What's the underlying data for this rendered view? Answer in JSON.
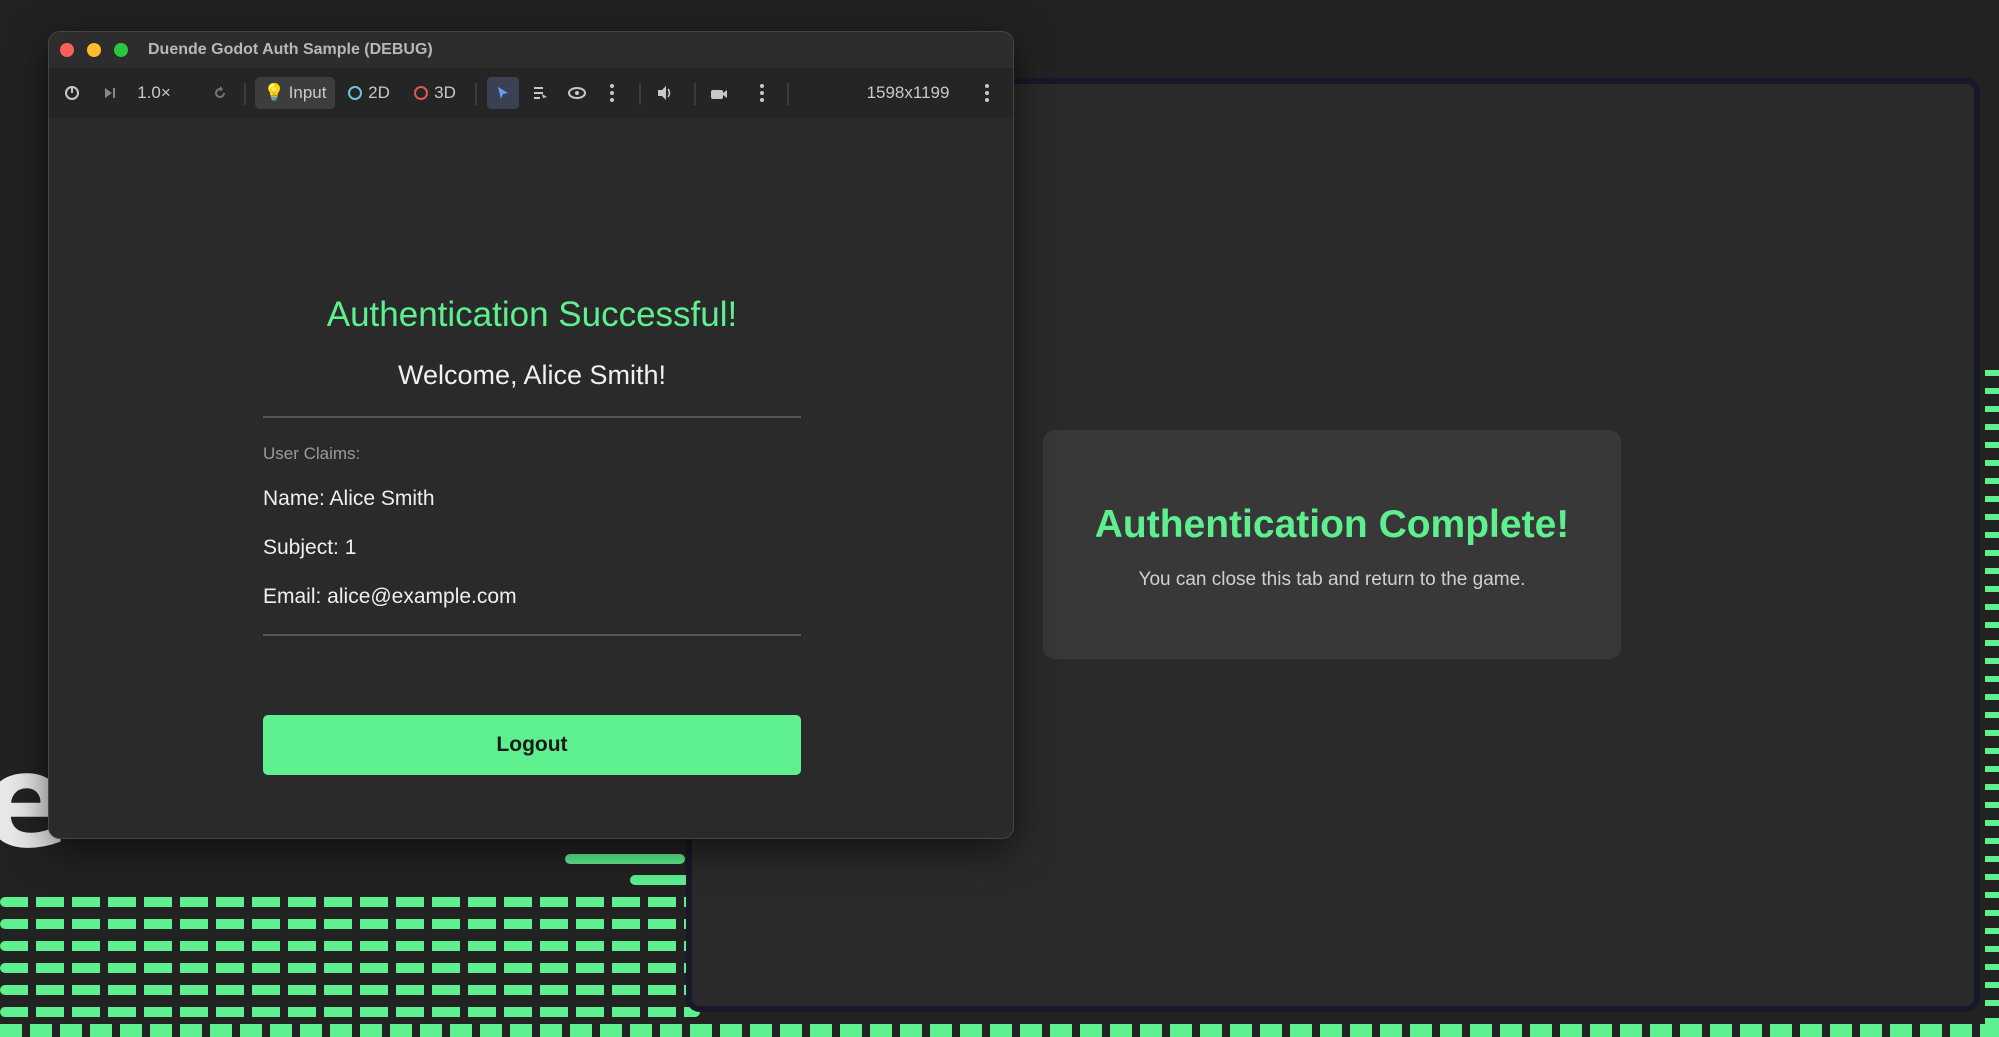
{
  "window": {
    "title": "Duende Godot Auth Sample (DEBUG)"
  },
  "toolbar": {
    "speed": "1.0×",
    "input_label": "Input",
    "mode_2d": "2D",
    "mode_3d": "3D",
    "resolution": "1598x1199"
  },
  "game": {
    "auth_title": "Authentication Successful!",
    "welcome": "Welcome, Alice Smith!",
    "claims_label": "User Claims:",
    "claims": [
      "Name: Alice Smith",
      "Subject: 1",
      "Email: alice@example.com"
    ],
    "logout_label": "Logout"
  },
  "browser": {
    "complete_title": "Authentication Complete!",
    "complete_subtitle": "You can close this tab and return to the game."
  },
  "colors": {
    "accent": "#5ef08f",
    "background": "#222222",
    "panel": "#2a2a2a"
  }
}
